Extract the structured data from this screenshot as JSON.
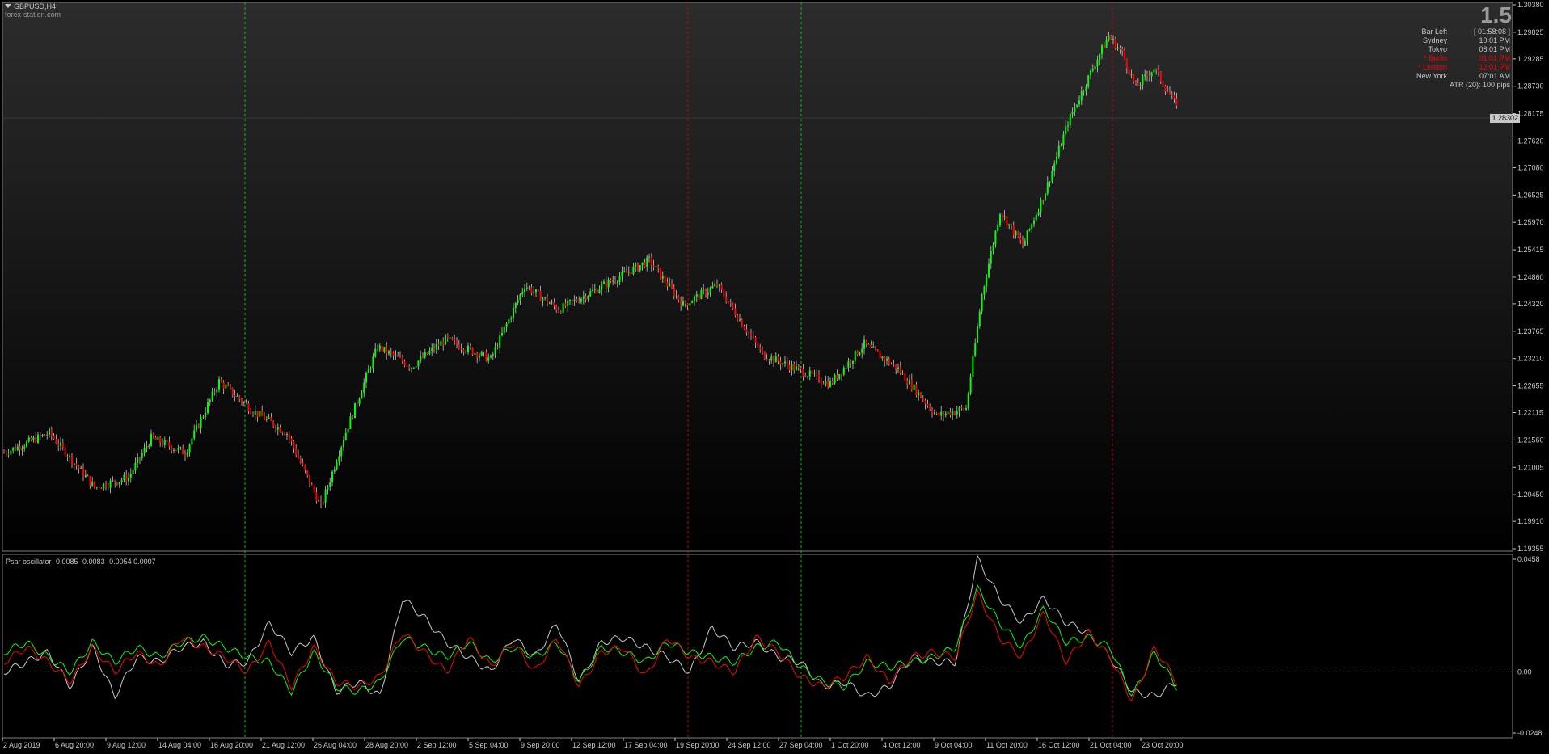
{
  "header": {
    "symbol": "GBPUSD,H4",
    "watermark": "forex-station.com",
    "spread": "1.5"
  },
  "sessions": {
    "rows": [
      {
        "label": "Bar Left",
        "value": "[ 01:58:08 ]",
        "color": "#c8c8c8"
      },
      {
        "label": "Sydney",
        "value": "10:01 PM",
        "color": "#c8c8c8"
      },
      {
        "label": "Tokyo",
        "value": "08:01 PM",
        "color": "#c8c8c8"
      },
      {
        "label": "* Berlin",
        "value": "01:01 PM",
        "color": "#ff0000"
      },
      {
        "label": "* London",
        "value": "12:01 PM",
        "color": "#ff0000"
      },
      {
        "label": "New York",
        "value": "07:01 AM",
        "color": "#c8c8c8"
      }
    ],
    "atr": "ATR (20): 100 pips"
  },
  "price_axis": {
    "ticks": [
      "1.30380",
      "1.29825",
      "1.29285",
      "1.28730",
      "1.28175",
      "1.27620",
      "1.27080",
      "1.26525",
      "1.25970",
      "1.25415",
      "1.24860",
      "1.24320",
      "1.23765",
      "1.23210",
      "1.22655",
      "1.22115",
      "1.21560",
      "1.21005",
      "1.20450",
      "1.19910",
      "1.19355"
    ],
    "current_price": "1.28302"
  },
  "oscillator": {
    "label": "Psar oscillator -0.0085 -0.0083 -0.0054 0.0007",
    "ticks": [
      "0.0458",
      "0.00",
      "-0.0248"
    ]
  },
  "time_axis": {
    "labels": [
      "2 Aug 2019",
      "6 Aug 20:00",
      "9 Aug 12:00",
      "14 Aug 04:00",
      "16 Aug 20:00",
      "21 Aug 12:00",
      "26 Aug 04:00",
      "28 Aug 20:00",
      "2 Sep 12:00",
      "5 Sep 04:00",
      "9 Sep 20:00",
      "12 Sep 12:00",
      "17 Sep 04:00",
      "19 Sep 20:00",
      "24 Sep 12:00",
      "27 Sep 04:00",
      "1 Oct 20:00",
      "4 Oct 12:00",
      "9 Oct 04:00",
      "11 Oct 20:00",
      "16 Oct 12:00",
      "21 Oct 04:00",
      "23 Oct 20:00"
    ]
  },
  "colors": {
    "bull": "#00ff00",
    "bear": "#ff0000",
    "wick": "#c8c8c8",
    "grid_green": "#00c800",
    "grid_red": "#c80000",
    "axis": "#c8c8c8"
  },
  "chart_data": {
    "type": "candlestick",
    "title": "GBPUSD,H4",
    "ylim": [
      1.19355,
      1.3038
    ],
    "anchors_price": [
      [
        0,
        1.213
      ],
      [
        20,
        1.217
      ],
      [
        40,
        1.206
      ],
      [
        55,
        1.208
      ],
      [
        65,
        1.216
      ],
      [
        80,
        1.213
      ],
      [
        95,
        1.2275
      ],
      [
        110,
        1.2215
      ],
      [
        125,
        1.217
      ],
      [
        140,
        1.202
      ],
      [
        150,
        1.216
      ],
      [
        165,
        1.2345
      ],
      [
        180,
        1.2305
      ],
      [
        195,
        1.236
      ],
      [
        215,
        1.232
      ],
      [
        230,
        1.247
      ],
      [
        245,
        1.242
      ],
      [
        265,
        1.247
      ],
      [
        285,
        1.252
      ],
      [
        300,
        1.243
      ],
      [
        315,
        1.247
      ],
      [
        335,
        1.233
      ],
      [
        350,
        1.23
      ],
      [
        365,
        1.227
      ],
      [
        380,
        1.235
      ],
      [
        395,
        1.23
      ],
      [
        412,
        1.2205
      ],
      [
        425,
        1.222
      ],
      [
        432,
        1.245
      ],
      [
        440,
        1.262
      ],
      [
        450,
        1.255
      ],
      [
        460,
        1.266
      ],
      [
        470,
        1.28
      ],
      [
        482,
        1.292
      ],
      [
        488,
        1.2975
      ],
      [
        494,
        1.294
      ],
      [
        500,
        1.287
      ],
      [
        508,
        1.291
      ],
      [
        517,
        1.284
      ]
    ],
    "oscillator_series": [
      {
        "color": "#c8c8c8",
        "values": [
          0,
          0.004,
          0.008,
          -0.006,
          0.01,
          -0.01,
          0.006,
          0.004,
          0.01,
          0.012,
          0.003,
          0.004,
          0.02,
          0.008,
          0.014,
          -0.008,
          -0.004,
          -0.01,
          0.03,
          0.022,
          0.012,
          0.006,
          0.0,
          0.014,
          0.006,
          0.02,
          -0.004,
          0.012,
          0.014,
          0.01,
          0.006,
          0.0,
          0.018,
          0.01,
          0.012,
          0.006,
          0.004,
          -0.006,
          -0.004,
          -0.01,
          -0.006,
          0.006,
          0.004,
          0.004,
          0.046,
          0.03,
          0.02,
          0.03,
          0.02,
          0.016,
          0.006,
          -0.008,
          -0.01,
          -0.004
        ]
      },
      {
        "color": "#00ff00",
        "values": [
          0.008,
          0.012,
          0.006,
          0.0,
          0.012,
          0.004,
          0.01,
          0.006,
          0.012,
          0.014,
          0.01,
          0.006,
          0.004,
          -0.008,
          0.008,
          -0.006,
          -0.008,
          -0.004,
          0.014,
          0.01,
          0.006,
          0.012,
          0.004,
          0.01,
          0.006,
          0.012,
          -0.004,
          0.01,
          0.008,
          0.004,
          0.012,
          0.008,
          0.006,
          0.004,
          0.01,
          0.012,
          0.002,
          -0.004,
          -0.006,
          0.004,
          0.002,
          0.004,
          0.006,
          0.01,
          0.034,
          0.02,
          0.01,
          0.026,
          0.012,
          0.014,
          0.01,
          -0.01,
          0.008,
          -0.006
        ]
      },
      {
        "color": "#ff0000",
        "values": [
          0.004,
          0.01,
          0.004,
          -0.004,
          0.01,
          0.0,
          0.008,
          0.002,
          0.014,
          0.01,
          0.006,
          0.0,
          0.012,
          -0.006,
          0.01,
          -0.004,
          -0.006,
          -0.002,
          0.016,
          0.008,
          0.0,
          0.014,
          0.002,
          0.012,
          0.0,
          0.014,
          -0.006,
          0.008,
          0.01,
          -0.002,
          0.014,
          0.006,
          0.004,
          0.0,
          0.014,
          0.008,
          -0.002,
          -0.006,
          -0.002,
          0.006,
          -0.004,
          0.006,
          0.008,
          0.006,
          0.032,
          0.014,
          0.006,
          0.024,
          0.004,
          0.016,
          0.006,
          -0.012,
          0.01,
          -0.004
        ]
      }
    ]
  }
}
